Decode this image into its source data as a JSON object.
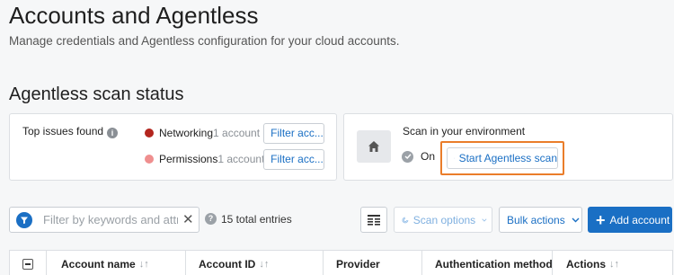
{
  "header": {
    "title": "Accounts and Agentless",
    "subtitle": "Manage credentials and Agentless configuration for your cloud accounts."
  },
  "scan_status": {
    "title": "Agentless scan status",
    "issues": {
      "label": "Top issues found",
      "items": [
        {
          "name": "Networking",
          "count": "1 account",
          "filter_label": "Filter acc...",
          "color": "#b3261e"
        },
        {
          "name": "Permissions",
          "count": "1 account",
          "filter_label": "Filter acc...",
          "color": "#ef8f8f"
        }
      ]
    },
    "environment": {
      "label": "Scan in your environment",
      "status": "On",
      "start_label": "Start Agentless scan"
    }
  },
  "toolbar": {
    "search_placeholder": "Filter by keywords and attr",
    "total_entries": "15 total entries",
    "scan_options_label": "Scan options",
    "bulk_actions_label": "Bulk actions",
    "add_account_label": "Add account"
  },
  "table": {
    "columns": [
      "Account name",
      "Account ID",
      "Provider",
      "Authentication method",
      "Actions"
    ]
  },
  "colors": {
    "accent": "#1a6fc4",
    "highlight": "#ea7d2a"
  }
}
